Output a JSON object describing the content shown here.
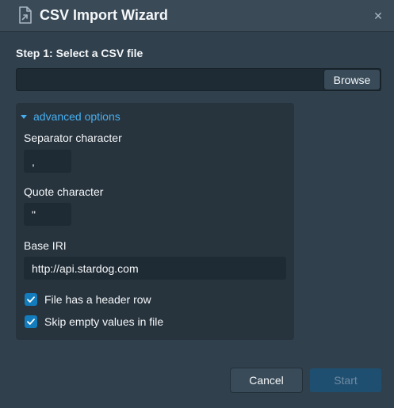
{
  "dialog": {
    "title": "CSV Import Wizard",
    "icon": "file-import-icon",
    "close_symbol": "✕"
  },
  "step1": {
    "label": "Step 1: Select a CSV file",
    "file_value": "",
    "browse_label": "Browse"
  },
  "advanced": {
    "toggle_label": "advanced options",
    "expanded": true,
    "separator": {
      "label": "Separator character",
      "value": ","
    },
    "quote": {
      "label": "Quote character",
      "value": "\""
    },
    "base_iri": {
      "label": "Base IRI",
      "value": "http://api.stardog.com"
    },
    "header_row": {
      "label": "File has a header row",
      "checked": true
    },
    "skip_empty": {
      "label": "Skip empty values in file",
      "checked": true
    }
  },
  "footer": {
    "cancel_label": "Cancel",
    "start_label": "Start"
  },
  "colors": {
    "background": "#30404d",
    "accent": "#48aff0",
    "checkbox": "#137cbd",
    "primary_disabled": "#1f4f70"
  }
}
